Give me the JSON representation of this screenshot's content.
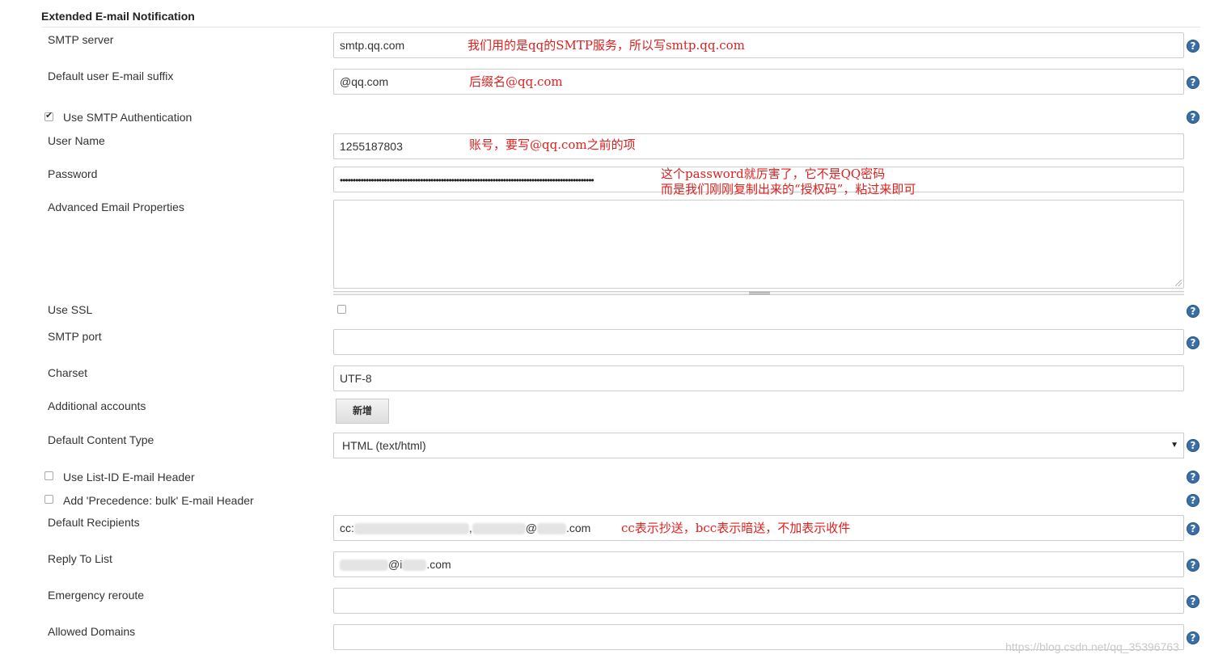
{
  "section": {
    "title": "Extended E-mail Notification"
  },
  "fields": {
    "smtp_server": {
      "label": "SMTP server",
      "value": "smtp.qq.com"
    },
    "email_suffix": {
      "label": "Default user E-mail suffix",
      "value": "@qq.com"
    },
    "use_smtp_auth": {
      "label": "Use SMTP Authentication",
      "checked": true
    },
    "user_name": {
      "label": "User Name",
      "value": "1255187803"
    },
    "password": {
      "label": "Password",
      "value": "••••••••••••••••••••••••••••••••••••••••••••••••••••••••••••••••••••••••••••••••••••••••••••••••••"
    },
    "advanced_props": {
      "label": "Advanced Email Properties",
      "value": ""
    },
    "use_ssl": {
      "label": "Use SSL",
      "checked": false
    },
    "smtp_port": {
      "label": "SMTP port",
      "value": ""
    },
    "charset": {
      "label": "Charset",
      "value": "UTF-8"
    },
    "additional_accounts": {
      "label": "Additional accounts",
      "button": "新增"
    },
    "content_type": {
      "label": "Default Content Type",
      "value": "HTML (text/html)"
    },
    "list_id_header": {
      "label": "Use List-ID E-mail Header",
      "checked": false
    },
    "precedence_header": {
      "label": "Add 'Precedence: bulk' E-mail Header",
      "checked": false
    },
    "default_recipients": {
      "label": "Default Recipients",
      "prefix": "cc:",
      "sep": ",",
      "at": "@",
      "suffix": ".com"
    },
    "reply_to": {
      "label": "Reply To List",
      "at": "@i",
      "suffix": ".com"
    },
    "emergency_reroute": {
      "label": "Emergency reroute",
      "value": ""
    },
    "allowed_domains": {
      "label": "Allowed Domains",
      "value": ""
    }
  },
  "annotations": {
    "smtp": "我们用的是qq的SMTP服务，所以写smtp.qq.com",
    "suffix": "后缀名@qq.com",
    "user": "账号，要写@qq.com之前的项",
    "password_line1": "这个password就厉害了，它不是QQ密码",
    "password_line2": "而是我们刚刚复制出来的“授权码”，粘过来即可",
    "recipients": "cc表示抄送，bcc表示暗送，不加表示收件"
  },
  "help_icon_glyph": "?",
  "watermark": "https://blog.csdn.net/qq_35396763",
  "colors": {
    "annotation": "#e0201e",
    "help_icon": "#3a6ea5"
  }
}
